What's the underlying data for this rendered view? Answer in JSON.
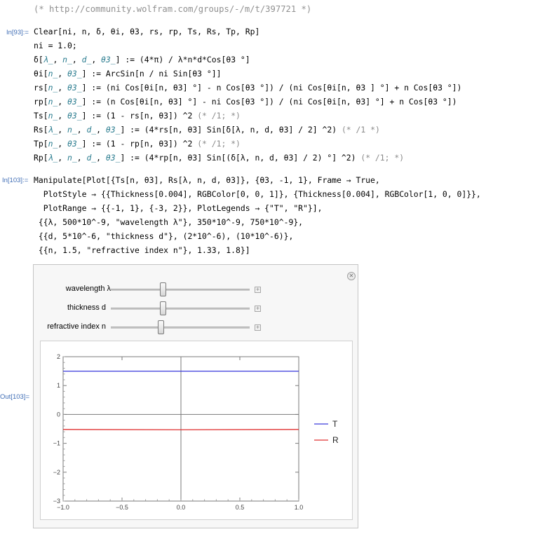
{
  "header_comment": "(* http://community.wolfram.com/groups/-/m/t/397721 *)",
  "cells": {
    "in93_label": "In[93]:=",
    "in103_label": "In[103]:=",
    "out103_label": "Out[103]="
  },
  "code93": [
    "Clear[ni, n, δ, θi, θ3, rs, rp, Ts, Rs, Tp, Rp]",
    "ni = 1.0;",
    "δ[λ_, n_, d_, θ3_] := (4*π) / λ*n*d*Cos[θ3 °]",
    "θi[n_, θ3_] := ArcSin[n / ni Sin[θ3 °]]",
    "rs[n_, θ3_] := (ni Cos[θi[n, θ3] °] - n Cos[θ3 °]) / (ni Cos[θi[n, θ3 ] °] + n Cos[θ3 °])",
    "rp[n_, θ3_] := (n Cos[θi[n, θ3] °] - ni Cos[θ3 °]) / (ni Cos[θi[n, θ3] °] + n Cos[θ3 °])",
    "Ts[n_, θ3_] := (1 - rs[n, θ3]) ^2 (* /1; *)",
    "Rs[λ_, n_, d_, θ3_] := (4*rs[n, θ3] Sin[δ[λ, n, d, θ3] / 2] ^2) (* /1 *)",
    "Tp[n_, θ3_] := (1 - rp[n, θ3]) ^2 (* /1; *)",
    "Rp[λ_, n_, d_, θ3_] := (4*rp[n, θ3] Sin[(δ[λ, n, d, θ3] / 2) °] ^2) (* /1; *)"
  ],
  "code103": [
    "Manipulate[Plot[{Ts[n, θ3], Rs[λ, n, d, θ3]}, {θ3, -1, 1}, Frame → True,",
    "  PlotStyle → {{Thickness[0.004], RGBColor[0, 0, 1]}, {Thickness[0.004], RGBColor[1, 0, 0]}},",
    "  PlotRange → {{-1, 1}, {-3, 2}}, PlotLegends → {\"T\", \"R\"}],",
    " {{λ, 500*10^-9, \"wavelength λ\"}, 350*10^-9, 750*10^-9},",
    " {{d, 5*10^-6, \"thickness d\"}, (2*10^-6), (10*10^-6)},",
    " {{n, 1.5, \"refractive index n\"}, 1.33, 1.8}]"
  ],
  "manipulate": {
    "controls": [
      {
        "label": "wavelength λ",
        "min": 3.5e-07,
        "max": 7.5e-07,
        "value": 5e-07
      },
      {
        "label": "thickness d",
        "min": 2e-06,
        "max": 1e-05,
        "value": 5e-06
      },
      {
        "label": "refractive index n",
        "min": 1.33,
        "max": 1.8,
        "value": 1.5
      }
    ]
  },
  "chart_data": {
    "type": "line",
    "xlim": [
      -1,
      1
    ],
    "ylim": [
      -3,
      2
    ],
    "x_ticks": [
      "−1.0",
      "−0.5",
      "0.0",
      "0.5",
      "1.0"
    ],
    "y_ticks": [
      "2",
      "1",
      "0",
      "−1",
      "−2",
      "−3"
    ],
    "grid": false,
    "frame": true,
    "legend_placement": "right",
    "series": [
      {
        "name": "T",
        "color": "#3a3adc",
        "x": [
          -1,
          0,
          1
        ],
        "y": [
          1.5,
          1.5,
          1.5
        ]
      },
      {
        "name": "R",
        "color": "#e03030",
        "x": [
          -1,
          0,
          1
        ],
        "y": [
          -0.52,
          -0.53,
          -0.52
        ]
      }
    ]
  }
}
